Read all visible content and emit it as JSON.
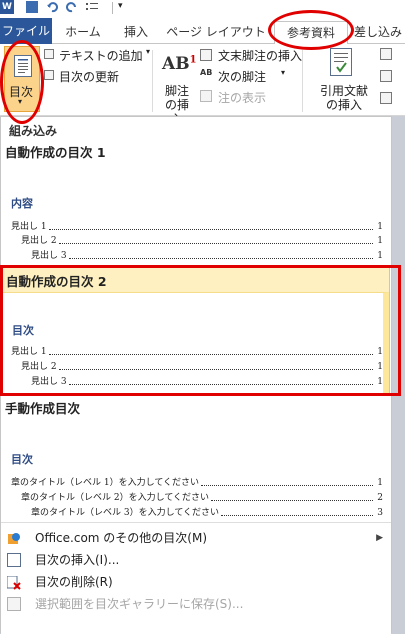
{
  "tabs": {
    "file": "ファイル",
    "home": "ホーム",
    "insert": "挿入",
    "layout": "ページ レイアウト",
    "references": "参考資料",
    "mailings": "差し込み"
  },
  "ribbon": {
    "toc_button": "目次",
    "add_text": "テキストの追加",
    "update_toc": "目次の更新",
    "insert_footnote": "脚注の挿入",
    "insert_endnote": "文末脚注の挿入",
    "next_footnote": "次の脚注",
    "show_notes": "注の表示",
    "insert_citation": "引用文献の挿入"
  },
  "gallery": {
    "section_builtin": "組み込み",
    "auto_toc1": {
      "name": "自動作成の目次 1",
      "heading": "内容",
      "entries": [
        {
          "text": "見出し 1",
          "page": "1"
        },
        {
          "text": "見出し 2",
          "page": "1"
        },
        {
          "text": "見出し 3",
          "page": "1"
        }
      ]
    },
    "auto_toc2": {
      "name": "自動作成の目次 2",
      "heading": "目次",
      "entries": [
        {
          "text": "見出し 1",
          "page": "1"
        },
        {
          "text": "見出し 2",
          "page": "1"
        },
        {
          "text": "見出し 3",
          "page": "1"
        }
      ]
    },
    "manual_toc": {
      "name": "手動作成目次",
      "heading": "目次",
      "entries": [
        {
          "text": "章のタイトル（レベル 1）を入力してください",
          "page": "1"
        },
        {
          "text": "章のタイトル（レベル 2）を入力してください",
          "page": "2"
        },
        {
          "text": "章のタイトル（レベル 3）を入力してください",
          "page": "3"
        }
      ]
    }
  },
  "menu": {
    "more_toc": "Office.com のその他の目次(M)",
    "custom_toc": "目次の挿入(I)...",
    "remove_toc": "目次の削除(R)",
    "save_selection": "選択範囲を目次ギャラリーに保存(S)..."
  },
  "colors": {
    "file_tab": "#2b579a",
    "highlight": "#fef0c0",
    "annotation": "#e00000",
    "toc_heading": "#2e4b84"
  }
}
